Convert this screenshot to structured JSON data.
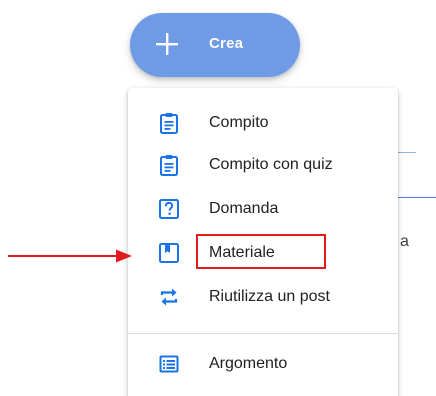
{
  "create_button": {
    "label": "Crea",
    "icon": "plus-icon",
    "color": "#6f9be6"
  },
  "menu": {
    "items": [
      {
        "label": "Compito",
        "icon": "assignment-icon"
      },
      {
        "label": "Compito con quiz",
        "icon": "quiz-assignment-icon"
      },
      {
        "label": "Domanda",
        "icon": "question-icon"
      },
      {
        "label": "Materiale",
        "icon": "material-icon"
      },
      {
        "label": "Riutilizza un post",
        "icon": "reuse-icon"
      },
      {
        "label": "Argomento",
        "icon": "topic-list-icon"
      }
    ]
  },
  "background": {
    "fragment_text": "a"
  },
  "annotation": {
    "highlight_color": "#e01b1b",
    "highlighted_item": "Materiale"
  },
  "colors": {
    "icon_blue": "#1a73e8",
    "text": "#202124"
  }
}
